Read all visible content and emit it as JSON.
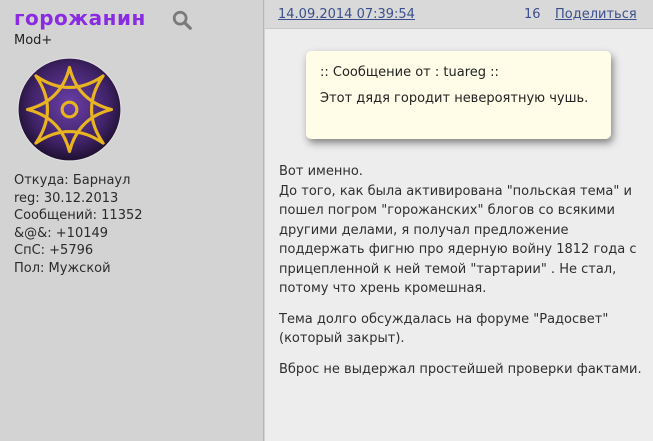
{
  "user": {
    "name": "горожанин",
    "rank": "Mod+",
    "info": [
      "Откуда: Барнаул",
      "reg: 30.12.2013",
      "Сообщений: 11352",
      "&@&: +10149",
      "СпС: +5796",
      "Пол: Мужской"
    ]
  },
  "post": {
    "date": "14.09.2014 07:39:54",
    "number": "16",
    "share_label": "Поделиться",
    "quote": {
      "title": ":: Сообщение от : tuareg ::",
      "text": "Этот дядя городит невероятную чушь."
    },
    "paragraphs": [
      "Вот именно.\nДо того, как была активирована \"польская тема\" и пошел погром \"горожанских\" блогов со всякими другими делами, я получал предложение поддержать фигню про ядерную войну 1812 года с прицепленной к ней темой \"тартарии\" . Не стал, потому что хрень кромешная.",
      "Тема долго обсуждалась на форуме \"Радосвет\" (который закрыт).",
      "Вброс не выдержал простейшей проверки фактами."
    ]
  },
  "colors": {
    "username": "#8a2be2",
    "link": "#3b4f8c",
    "sidebar_bg": "#d3d3d3",
    "content_bg": "#ededed",
    "quote_bg": "#fffce8",
    "avatar_purple": "#4b2a7a",
    "avatar_gold": "#e8b420"
  }
}
